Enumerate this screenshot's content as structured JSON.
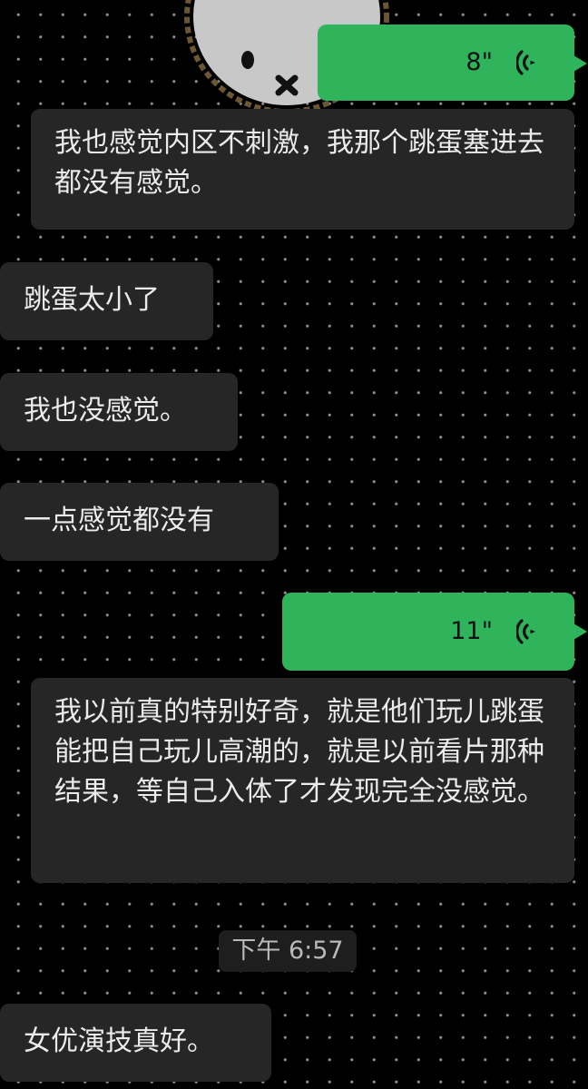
{
  "chat": {
    "messages": [
      {
        "sender": "self",
        "type": "voice",
        "duration": "8\""
      },
      {
        "sender": "other",
        "type": "text",
        "text": "我也感觉内区不刺激，我那个跳蛋塞进去都没有感觉。"
      },
      {
        "sender": "other",
        "type": "text",
        "text": "跳蛋太小了"
      },
      {
        "sender": "other",
        "type": "text",
        "text": "我也没感觉。"
      },
      {
        "sender": "other",
        "type": "text",
        "text": "一点感觉都没有"
      },
      {
        "sender": "self",
        "type": "voice",
        "duration": "11\""
      },
      {
        "sender": "other",
        "type": "text",
        "text": "我以前真的特别好奇，就是他们玩儿跳蛋能把自己玩儿高潮的，就是以前看片那种结果，等自己入体了才发现完全没感觉。"
      },
      {
        "sender": "system",
        "type": "timestamp",
        "text": "下午 6:57"
      },
      {
        "sender": "other",
        "type": "text",
        "text": "女优演技真好。"
      }
    ]
  },
  "colors": {
    "background": "#000000",
    "dot": "#8d8d8d",
    "incoming_bubble": "#262626",
    "outgoing_bubble": "#2fb45b",
    "timestamp_bg": "#1e1e1e"
  },
  "icons": {
    "voice": "voice-wave-icon",
    "avatar": "bunny-face-avatar"
  }
}
